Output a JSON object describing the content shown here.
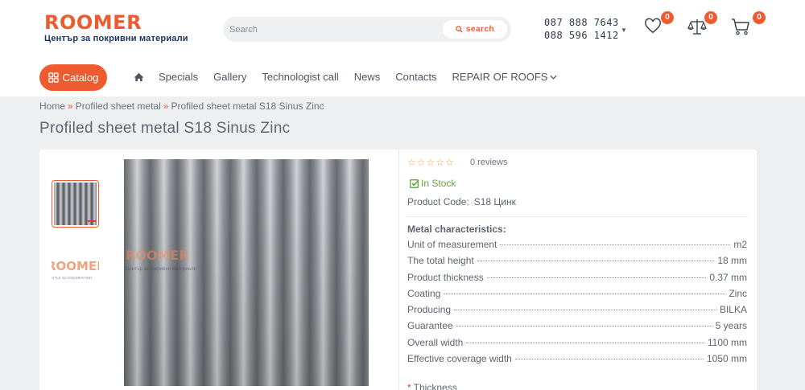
{
  "brand": {
    "logo_text": "ROOMER",
    "tagline": "Център за покривни материали",
    "accent": "#ef5b31",
    "navy": "#1f3460"
  },
  "header": {
    "search_placeholder": "Search",
    "search_button": "search",
    "phones": [
      "087 888 7643",
      "088 596 1412"
    ],
    "wishlist_count": "0",
    "compare_count": "0",
    "cart_count": "0",
    "icons": [
      "heart-icon",
      "scales-icon",
      "cart-icon",
      "search-icon",
      "chevron-down-icon"
    ]
  },
  "nav": {
    "catalog": "Catalog",
    "items": [
      "Specials",
      "Gallery",
      "Technologist call",
      "News",
      "Contacts",
      "REPAIR OF ROOFS"
    ]
  },
  "breadcrumb": [
    "Home",
    "Profiled sheet metal",
    "Profiled sheet metal S18 Sinus Zinc"
  ],
  "breadcrumb_sep": "»",
  "product": {
    "title": "Profiled sheet metal S18 Sinus Zinc",
    "rating": 0,
    "reviews": "0 reviews",
    "stock": "In Stock",
    "code_label": "Product Code:",
    "code": "S18 Цинк",
    "characteristics_title": "Metal characteristics:",
    "specs": [
      {
        "k": "Unit of measurement",
        "v": "m2"
      },
      {
        "k": "The total height",
        "v": "18 mm"
      },
      {
        "k": "Product thickness",
        "v": "0.37 mm"
      },
      {
        "k": "Coating",
        "v": "Zinc"
      },
      {
        "k": "Producing",
        "v": "BILKA"
      },
      {
        "k": "Guarantee",
        "v": "5 years"
      },
      {
        "k": "Overall width",
        "v": "1100 mm"
      },
      {
        "k": "Effective coverage width",
        "v": "1050 mm"
      }
    ],
    "option_required": "*",
    "option_label": "Thickness",
    "stock_color": "#64a53c"
  }
}
